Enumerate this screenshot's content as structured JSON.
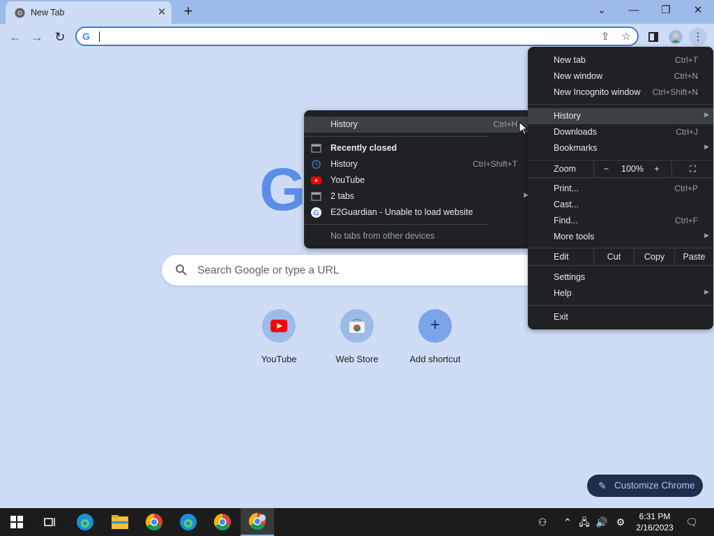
{
  "tab": {
    "title": "New Tab",
    "close_icon": "close-icon"
  },
  "toolbar": {
    "new_tab_symbol": "+"
  },
  "omnibox": {
    "value": ""
  },
  "page": {
    "search_placeholder": "Search Google or type a URL",
    "shortcuts": [
      {
        "label": "YouTube"
      },
      {
        "label": "Web Store"
      },
      {
        "label": "Add shortcut"
      }
    ],
    "customize_label": "Customize Chrome"
  },
  "menu": {
    "new_tab": "New tab",
    "new_tab_sc": "Ctrl+T",
    "new_window": "New window",
    "new_window_sc": "Ctrl+N",
    "incognito": "New Incognito window",
    "incognito_sc": "Ctrl+Shift+N",
    "history": "History",
    "downloads": "Downloads",
    "downloads_sc": "Ctrl+J",
    "bookmarks": "Bookmarks",
    "zoom": "Zoom",
    "zoom_minus": "−",
    "zoom_value": "100%",
    "zoom_plus": "+",
    "print": "Print...",
    "print_sc": "Ctrl+P",
    "cast": "Cast...",
    "find": "Find...",
    "find_sc": "Ctrl+F",
    "more_tools": "More tools",
    "edit": "Edit",
    "cut": "Cut",
    "copy": "Copy",
    "paste": "Paste",
    "settings": "Settings",
    "help": "Help",
    "exit": "Exit"
  },
  "history_menu": {
    "history": "History",
    "history_sc": "Ctrl+H",
    "recently_closed": "Recently closed",
    "history_item": "History",
    "history_item_sc": "Ctrl+Shift+T",
    "youtube": "YouTube",
    "two_tabs": "2 tabs",
    "e2guardian": "E2Guardian - Unable to load website",
    "no_tabs": "No tabs from other devices"
  },
  "taskbar": {
    "time": "6:31 PM",
    "date": "2/16/2023"
  },
  "colors": {
    "accent": "#4a78c2",
    "menu_bg": "#202124",
    "page_bg": "#cfdcf5",
    "tabstrip_bg": "#9dbbe8"
  }
}
